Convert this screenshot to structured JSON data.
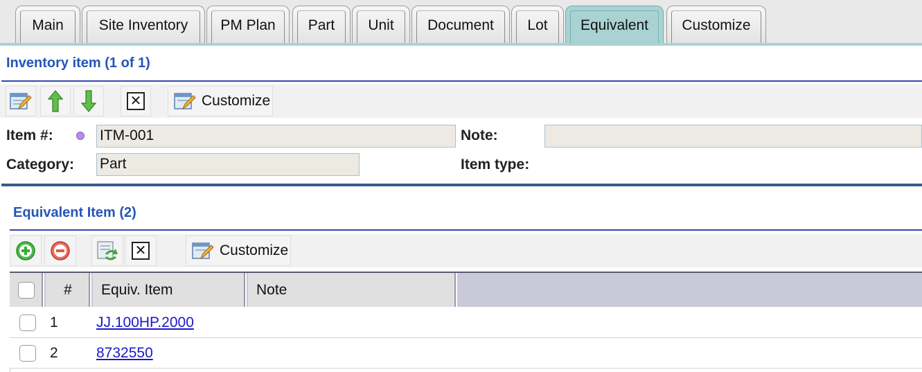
{
  "tabs": [
    {
      "label": "Main",
      "active": false
    },
    {
      "label": "Site Inventory",
      "active": false
    },
    {
      "label": "PM Plan",
      "active": false
    },
    {
      "label": "Part",
      "active": false
    },
    {
      "label": "Unit",
      "active": false
    },
    {
      "label": "Document",
      "active": false
    },
    {
      "label": "Lot",
      "active": false
    },
    {
      "label": "Equivalent",
      "active": true
    },
    {
      "label": "Customize",
      "active": false
    }
  ],
  "inventory": {
    "title": "Inventory item (1 of 1)",
    "toolbar": {
      "edit_icon": "edit-icon",
      "up_icon": "arrow-up-icon",
      "down_icon": "arrow-down-icon",
      "close_icon": "close-box-icon",
      "customize_label": "Customize"
    },
    "fields": {
      "item_label": "Item #:",
      "item_value": "ITM-001",
      "note_label": "Note:",
      "note_value": "",
      "category_label": "Category:",
      "category_value": "Part",
      "item_type_label": "Item type:",
      "item_type_value": ""
    }
  },
  "equivalent": {
    "title": "Equivalent Item (2)",
    "toolbar": {
      "add_icon": "add-icon",
      "remove_icon": "remove-icon",
      "refresh_icon": "refresh-icon",
      "close_icon": "close-box-icon",
      "customize_label": "Customize"
    },
    "columns": [
      "#",
      "Equiv. Item",
      "Note"
    ],
    "rows": [
      {
        "num": "1",
        "item": "JJ.100HP.2000",
        "note": ""
      },
      {
        "num": "2",
        "item": "8732550",
        "note": ""
      }
    ]
  },
  "colors": {
    "accent_tab": "#a9d3d3",
    "title_blue": "#2455b8",
    "link_blue": "#1c18c9",
    "add_green": "#3aa83a",
    "remove_red": "#e05a4a"
  }
}
